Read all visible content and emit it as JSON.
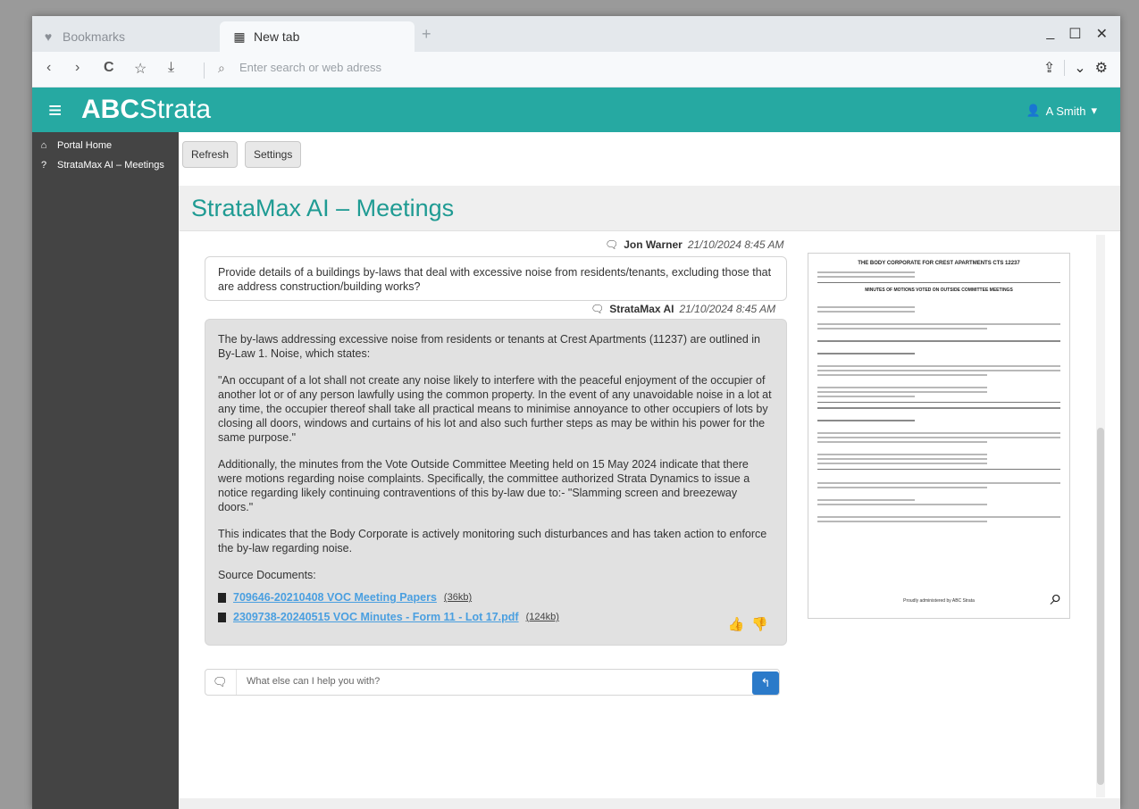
{
  "browser": {
    "tabs": [
      {
        "label": "Bookmarks",
        "icon": "heart-icon"
      },
      {
        "label": "New tab",
        "icon": "grid-icon"
      }
    ],
    "address_placeholder": "Enter search or web adress"
  },
  "app": {
    "brand_bold": "ABC",
    "brand_light": "Strata",
    "user": "A Smith",
    "accent": "#26a9a2"
  },
  "sidebar": {
    "items": [
      {
        "label": "Portal Home",
        "icon": "home-icon"
      },
      {
        "label": "StrataMax AI – Meetings",
        "icon": "help-circle-icon"
      }
    ]
  },
  "toolbar": {
    "refresh_label": "Refresh",
    "settings_label": "Settings"
  },
  "page": {
    "title": "StrataMax AI – Meetings"
  },
  "chat": {
    "question": {
      "author": "Jon Warner",
      "timestamp": "21/10/2024 8:45 AM",
      "text": "Provide details of a buildings by-laws that deal with excessive noise from residents/tenants, excluding those that are address construction/building works?"
    },
    "answer": {
      "author": "StrataMax AI",
      "timestamp": "21/10/2024 8:45 AM",
      "paragraphs": [
        "The by-laws addressing excessive noise from residents or tenants at Crest Apartments (11237) are outlined in By-Law 1. Noise, which states:",
        "\"An occupant of a lot shall not create any noise likely to interfere with the peaceful enjoyment of the occupier of another lot or of any person lawfully using the common property. In the event of any unavoidable noise in a lot at any time, the occupier thereof shall take all practical means to minimise annoyance to other occupiers of lots by closing all doors, windows and curtains of his lot and also such further steps as may be within his power for the same purpose.\"",
        "Additionally, the minutes from the Vote Outside Committee Meeting held on 15 May 2024 indicate that there were motions regarding noise complaints. Specifically, the committee authorized Strata Dynamics to issue a notice regarding likely continuing contraventions of this by-law due to:- \"Slamming screen and breezeway doors.\"",
        "This indicates that the Body Corporate is actively monitoring such disturbances and has taken action to enforce the by-law regarding noise."
      ],
      "sources_label": "Source Documents:",
      "sources": [
        {
          "name": "709646-20210408 VOC Meeting Papers",
          "size": "(36kb)"
        },
        {
          "name": "2309738-20240515 VOC Minutes - Form 11 - Lot 17.pdf",
          "size": "(124kb)"
        }
      ]
    },
    "input_placeholder": "What else can I help you with?"
  },
  "preview": {
    "doc_title": "THE BODY CORPORATE FOR CREST APARTMENTS CTS 12237",
    "doc_subtitle": "MINUTES OF MOTIONS VOTED ON OUTSIDE COMMITTEE MEETINGS",
    "footer": "Proudly administered by ABC Strata"
  }
}
